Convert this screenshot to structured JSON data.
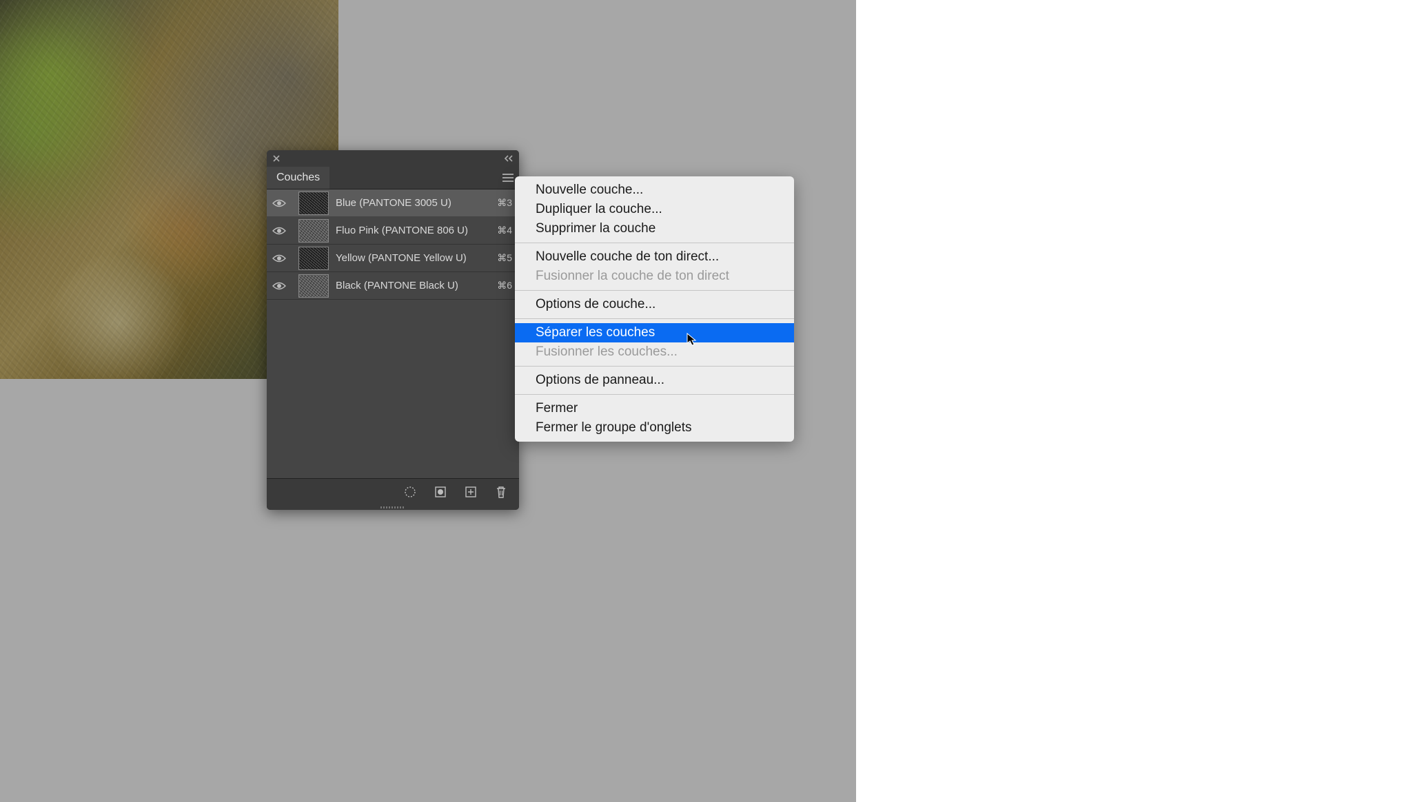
{
  "panel": {
    "tab_label": "Couches",
    "channels": [
      {
        "name": "Blue (PANTONE 3005 U)",
        "shortcut": "⌘3",
        "selected": true
      },
      {
        "name": "Fluo Pink (PANTONE 806 U)",
        "shortcut": "⌘4",
        "selected": false
      },
      {
        "name": "Yellow (PANTONE Yellow U)",
        "shortcut": "⌘5",
        "selected": false
      },
      {
        "name": "Black (PANTONE Black U)",
        "shortcut": "⌘6",
        "selected": false
      }
    ]
  },
  "context_menu": {
    "items": [
      {
        "label": "Nouvelle couche...",
        "disabled": false,
        "highlight": false,
        "type": "item"
      },
      {
        "label": "Dupliquer la couche...",
        "disabled": false,
        "highlight": false,
        "type": "item"
      },
      {
        "label": "Supprimer la couche",
        "disabled": false,
        "highlight": false,
        "type": "item"
      },
      {
        "type": "sep"
      },
      {
        "label": "Nouvelle couche de ton direct...",
        "disabled": false,
        "highlight": false,
        "type": "item"
      },
      {
        "label": "Fusionner la couche de ton direct",
        "disabled": true,
        "highlight": false,
        "type": "item"
      },
      {
        "type": "sep"
      },
      {
        "label": "Options de couche...",
        "disabled": false,
        "highlight": false,
        "type": "item"
      },
      {
        "type": "sep"
      },
      {
        "label": "Séparer les couches",
        "disabled": false,
        "highlight": true,
        "type": "item"
      },
      {
        "label": "Fusionner les couches...",
        "disabled": true,
        "highlight": false,
        "type": "item"
      },
      {
        "type": "sep"
      },
      {
        "label": "Options de panneau...",
        "disabled": false,
        "highlight": false,
        "type": "item"
      },
      {
        "type": "sep"
      },
      {
        "label": "Fermer",
        "disabled": false,
        "highlight": false,
        "type": "item"
      },
      {
        "label": "Fermer le groupe d'onglets",
        "disabled": false,
        "highlight": false,
        "type": "item"
      }
    ]
  }
}
